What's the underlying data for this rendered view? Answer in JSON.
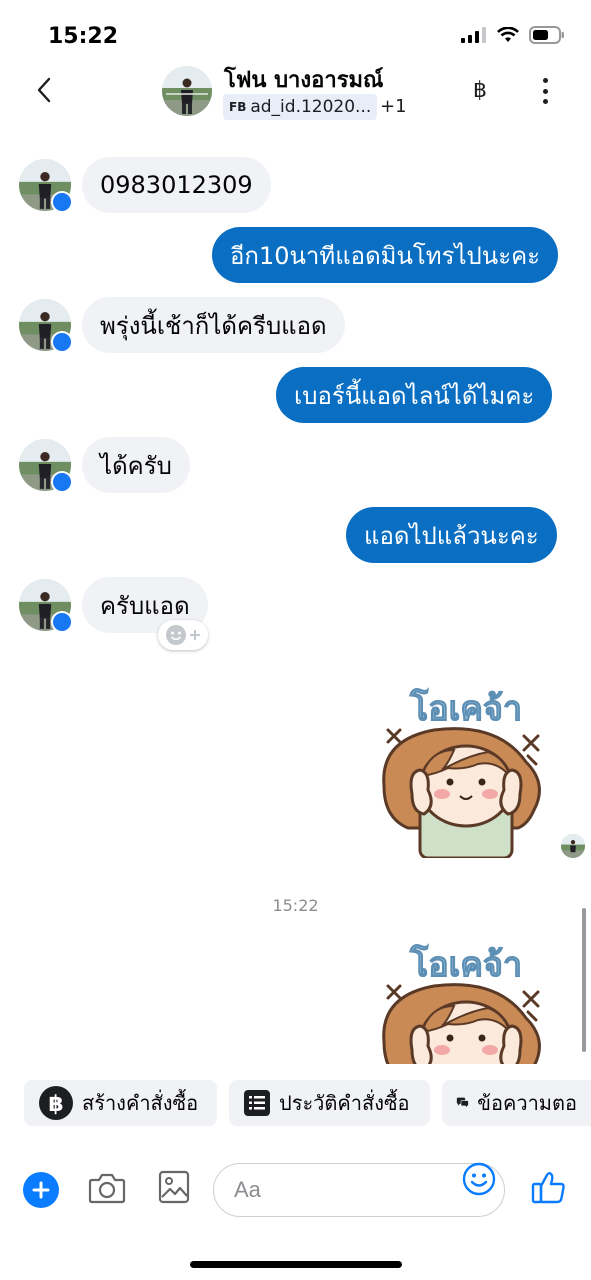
{
  "status_bar": {
    "time": "15:22"
  },
  "header": {
    "contact_name": "โฟน บางอารมณ์",
    "source_tag": "FB",
    "ad_label": "ad_id.12020...",
    "extra_count": "+1",
    "currency_symbol": "฿"
  },
  "messages": [
    {
      "direction": "in",
      "text": "0983012309"
    },
    {
      "direction": "out",
      "text": "อีก10นาทีแอดมินโทรไปนะคะ"
    },
    {
      "direction": "in",
      "text": "พรุ่งนี้เช้าก็ได้ครีบแอด"
    },
    {
      "direction": "out",
      "text": "เบอร์นี้แอดไลน์ได้ไมคะ"
    },
    {
      "direction": "in",
      "text": "ได้ครับ"
    },
    {
      "direction": "out",
      "text": "แอดไปแล้วนะคะ"
    },
    {
      "direction": "in",
      "text": "ครับแอด"
    }
  ],
  "stickers": [
    {
      "caption": "โอเคจ้า"
    },
    {
      "caption": "โอเคจ้า"
    }
  ],
  "timestamp": "15:22",
  "quick_actions": [
    {
      "label": "สร้างคำสั่งซื้อ",
      "icon": "baht-circle-icon"
    },
    {
      "label": "ประวัติคำสั่งซื้อ",
      "icon": "order-list-icon"
    },
    {
      "label": "ข้อความตอ",
      "icon": "chat-bubbles-icon"
    }
  ],
  "composer": {
    "placeholder": "Aa"
  },
  "colors": {
    "outgoing_bubble": "#0a6fc2",
    "incoming_bubble": "#f0f2f5",
    "messenger_blue": "#0a7cff"
  }
}
